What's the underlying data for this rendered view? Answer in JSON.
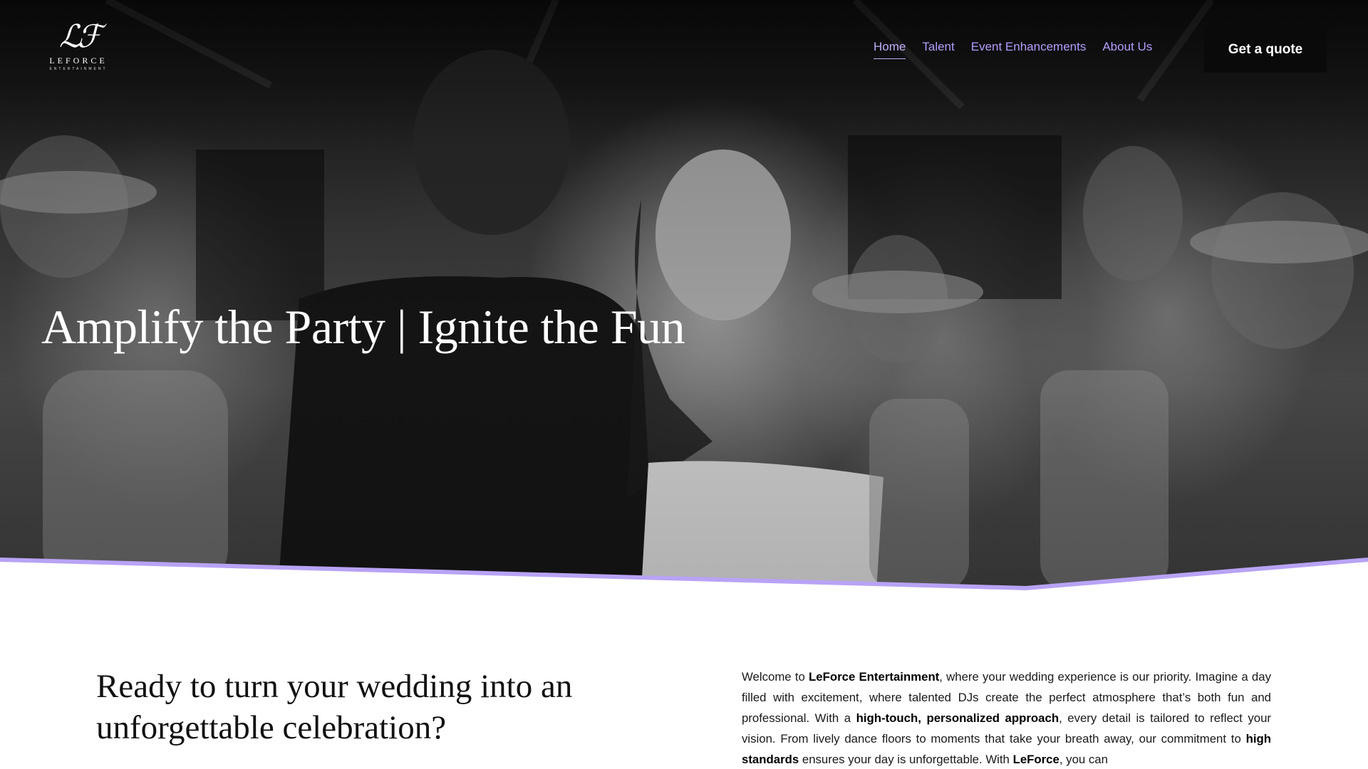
{
  "brand": {
    "logo_mark": "ℒℱ",
    "logo_word": "LEFORCE",
    "logo_sub": "ENTERTAINMENT"
  },
  "nav": {
    "items": [
      {
        "label": "Home",
        "active": true
      },
      {
        "label": "Talent",
        "active": false
      },
      {
        "label": "Event Enhancements",
        "active": false
      },
      {
        "label": "About Us",
        "active": false
      }
    ],
    "cta_label": "Get a quote"
  },
  "hero": {
    "title": "Amplify the Party | Ignite the Fun"
  },
  "intro": {
    "heading": "Ready to turn your wedding into an unforgettable celebration?",
    "body": {
      "p1": "Welcome to ",
      "b1": "LeForce Entertainment",
      "p2": ", where your wedding experience is our priority. Imagine a day filled with excitement, where talented DJs create the perfect atmosphere that’s both fun and professional. With a ",
      "b2": "high-touch, personalized approach",
      "p3": ", every detail is tailored to reflect your vision. From lively dance floors to moments that take your breath away, our commitment to ",
      "b3": "high standards",
      "p4": " ensures your day is unforgettable. With ",
      "b4": "LeForce",
      "p5": ", you can"
    }
  },
  "colors": {
    "accent": "#b49dfc",
    "cta_bg": "#0a0a0a",
    "wave": "#b8a3f5"
  }
}
